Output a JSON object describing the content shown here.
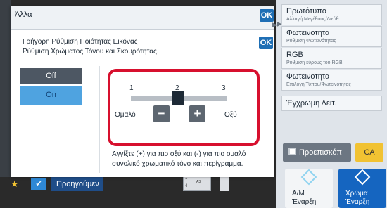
{
  "right_menu": {
    "items": [
      {
        "title": "Πρωτότυπο",
        "sub": "Αλλαγή Μεγέθους/Διεύθ"
      },
      {
        "title": "Φωτεινοτητα",
        "sub": "Ρύθμιση Φωτεινότητας"
      },
      {
        "title": "RGB",
        "sub": "Ρύθμιση εύρους του RGB"
      },
      {
        "title": "Φωτεινοτητα",
        "sub": "Επιλογή Τύπου/Φωτεινότητας"
      }
    ],
    "color_mode": "Έγχρωμη Λειτ."
  },
  "bottom": {
    "preview_label": "Προεπισκόπ",
    "ca_label": "CA",
    "bw_start_line1": "A/M",
    "bw_start_line2": "Έναρξη",
    "color_start_line1": "Χρώμα",
    "color_start_line2": "Έναρξη",
    "prev_label": "Προηγούμεν",
    "tray_1": "1",
    "tray_2": "4",
    "tray_size": "A3"
  },
  "outer_dialog": {
    "title": "Άλλα",
    "ok_label": "OK"
  },
  "inner_dialog": {
    "title_line1": "Γρήγορη Ρύθμιση Ποιότητας Εικόνας",
    "title_line2": "Ρύθμιση Χρώματος Τόνου και Σκουρότητας.",
    "ok_label": "OK",
    "option_off": "Off",
    "option_on": "On",
    "selected_option": "On",
    "scale": [
      "1",
      "2",
      "3"
    ],
    "current_level": 2,
    "label_left": "Ομαλό",
    "label_right": "Οξύ",
    "minus_label": "−",
    "plus_label": "+",
    "help_line1": "Αγγίξτε (+) για πιο οξύ και (-) για πιο ομαλό",
    "help_line2": "συνολικό χρωματικό τόνο και περίγραμμα."
  },
  "colors": {
    "accent_blue": "#1f6fb5",
    "selected_option": "#4fa3e0",
    "highlight_red": "#d7102e",
    "ca_yellow": "#f1c232",
    "color_start": "#1565c0"
  }
}
